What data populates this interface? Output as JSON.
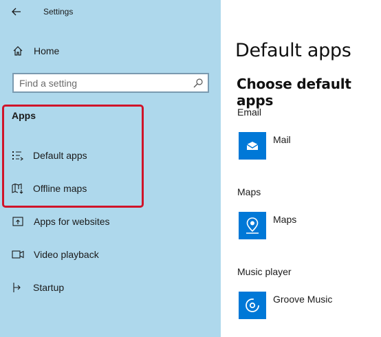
{
  "window": {
    "title": "Settings"
  },
  "sidebar": {
    "home_label": "Home",
    "search_placeholder": "Find a setting",
    "section_header": "Apps",
    "items": [
      {
        "label": "Default apps",
        "icon": "default-apps-icon"
      },
      {
        "label": "Offline maps",
        "icon": "offline-maps-icon"
      },
      {
        "label": "Apps for websites",
        "icon": "apps-for-websites-icon"
      },
      {
        "label": "Video playback",
        "icon": "video-playback-icon"
      },
      {
        "label": "Startup",
        "icon": "startup-icon"
      }
    ]
  },
  "main": {
    "title": "Default apps",
    "subtitle": "Choose default apps",
    "categories": [
      {
        "label": "Email",
        "app": "Mail",
        "icon": "mail-icon"
      },
      {
        "label": "Maps",
        "app": "Maps",
        "icon": "maps-icon"
      },
      {
        "label": "Music player",
        "app": "Groove Music",
        "icon": "groove-music-icon"
      }
    ]
  },
  "colors": {
    "sidebar_bg": "#aed8ec",
    "accent": "#0078d7",
    "highlight": "#d0142a"
  }
}
